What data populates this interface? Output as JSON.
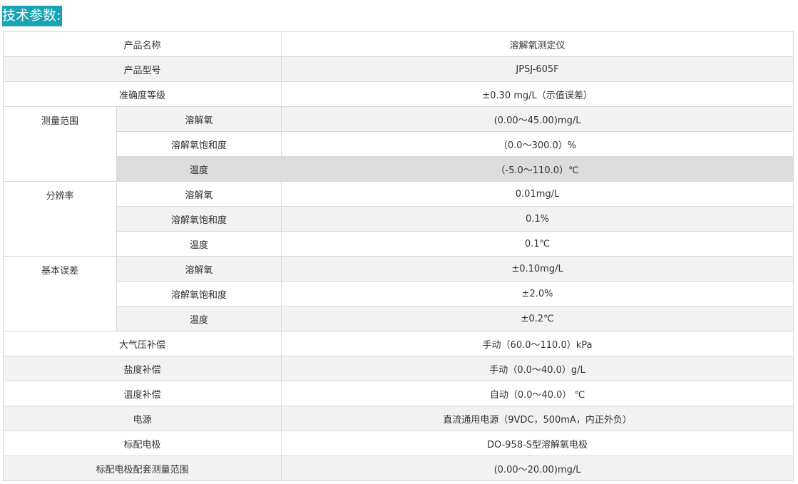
{
  "heading": "技术参数:",
  "rows": {
    "product_name": {
      "label": "产品名称",
      "value": "溶解氧测定仪"
    },
    "model": {
      "label": "产品型号",
      "value": "JPSJ-605F"
    },
    "accuracy_grade": {
      "label": "准确度等级",
      "value": "±0.30 mg/L（示值误差）"
    },
    "range": {
      "group": "测量范围",
      "do": {
        "label": "溶解氧",
        "value": "(0.00～45.00)mg/L"
      },
      "saturation": {
        "label": "溶解氧饱和度",
        "value": "（0.0～300.0）%"
      },
      "temperature": {
        "label": "温度",
        "value": "（-5.0～110.0）℃"
      }
    },
    "resolution": {
      "group": "分辨率",
      "do": {
        "label": "溶解氧",
        "value": "0.01mg/L"
      },
      "saturation": {
        "label": "溶解氧饱和度",
        "value": "0.1%"
      },
      "temperature": {
        "label": "温度",
        "value": "0.1℃"
      }
    },
    "basic_error": {
      "group": "基本误差",
      "do": {
        "label": "溶解氧",
        "value": "±0.10mg/L"
      },
      "saturation": {
        "label": "溶解氧饱和度",
        "value": "±2.0%"
      },
      "temperature": {
        "label": "温度",
        "value": "±0.2℃"
      }
    },
    "pressure_comp": {
      "label": "大气压补偿",
      "value": "手动（60.0～110.0）kPa"
    },
    "salinity_comp": {
      "label": "盐度补偿",
      "value": "手动（0.0～40.0）g/L"
    },
    "temperature_comp": {
      "label": "温度补偿",
      "value": "自动（0.0～40.0） ℃"
    },
    "power": {
      "label": "电源",
      "value": "直流通用电源（9VDC，500mA，内正外负）"
    },
    "electrode": {
      "label": "标配电极",
      "value": "DO-958-S型溶解氧电极"
    },
    "electrode_range": {
      "label": "标配电极配套测量范围",
      "value": "(0.00～20.00)mg/L"
    }
  }
}
